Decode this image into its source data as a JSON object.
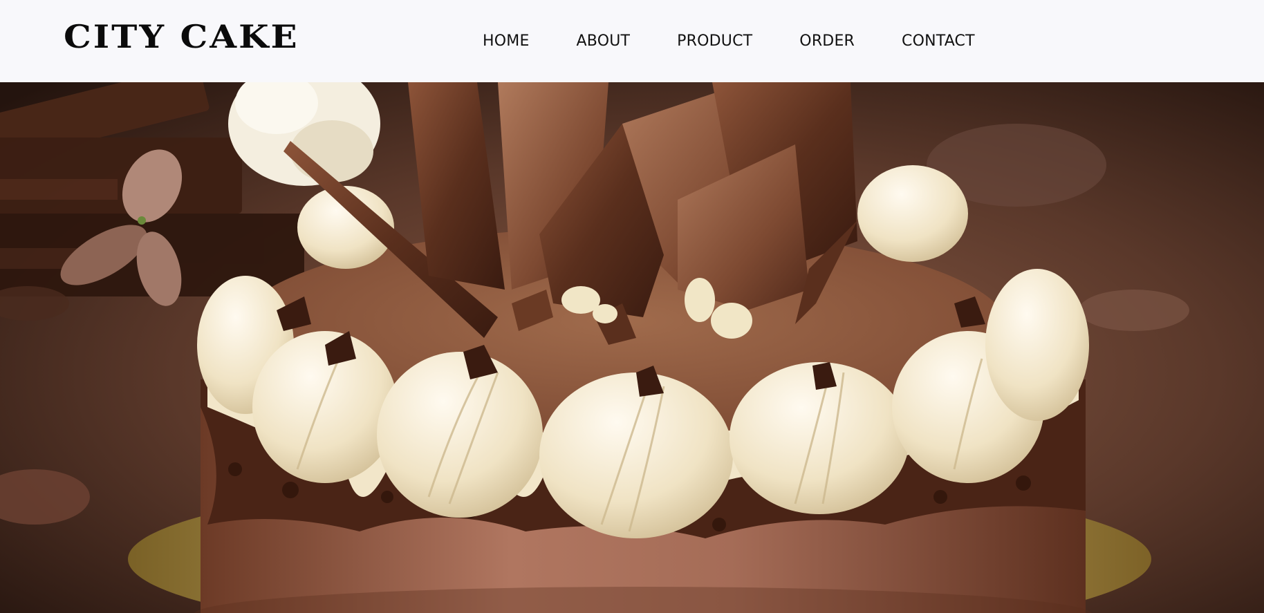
{
  "header": {
    "logo_text": "CITY CAKE"
  },
  "nav": {
    "items": [
      {
        "label": "HOME"
      },
      {
        "label": "ABOUT"
      },
      {
        "label": "PRODUCT"
      },
      {
        "label": "ORDER"
      },
      {
        "label": "CONTACT"
      }
    ]
  },
  "hero": {
    "image_subject": "chocolate cream cake",
    "colors": {
      "background_dark": "#2a1811",
      "chocolate": "#5a3220",
      "cream": "#f3ead2",
      "cocoa_top": "#9a6446",
      "gold_board": "#b89a4e"
    }
  }
}
